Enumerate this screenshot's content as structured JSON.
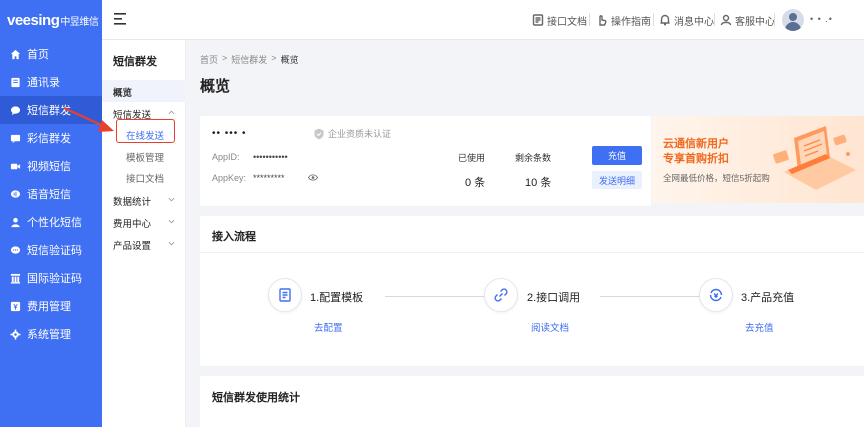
{
  "brand": {
    "logo_text": "veesing",
    "logo_cn": "中昱维信"
  },
  "sidebar": {
    "items": [
      {
        "label": "首页",
        "icon": "home-icon"
      },
      {
        "label": "通讯录",
        "icon": "contacts-icon"
      },
      {
        "label": "短信群发",
        "icon": "message-icon",
        "active": true
      },
      {
        "label": "彩信群发",
        "icon": "mms-icon"
      },
      {
        "label": "视频短信",
        "icon": "video-icon"
      },
      {
        "label": "语音短信",
        "icon": "voice-icon"
      },
      {
        "label": "个性化短信",
        "icon": "personalize-icon"
      },
      {
        "label": "短信验证码",
        "icon": "verify-icon"
      },
      {
        "label": "国际验证码",
        "icon": "international-icon"
      },
      {
        "label": "费用管理",
        "icon": "fee-icon"
      },
      {
        "label": "系统管理",
        "icon": "settings-icon"
      }
    ]
  },
  "header": {
    "links": [
      {
        "label": "接口文档",
        "icon": "document-icon"
      },
      {
        "label": "操作指南",
        "icon": "hand-icon"
      },
      {
        "label": "消息中心",
        "icon": "bell-icon"
      },
      {
        "label": "客服中心",
        "icon": "support-icon"
      }
    ],
    "username": "• • .•"
  },
  "subnav": {
    "title": "短信群发",
    "overview": "概览",
    "group_send": "短信发送",
    "send_online": "在线发送",
    "template": "模板管理",
    "api_doc": "接口文档",
    "data_stats": "数据统计",
    "fee_center": "费用中心",
    "product_settings": "产品设置"
  },
  "breadcrumb": {
    "home": "首页",
    "section": "短信群发",
    "current": "概览",
    "sep": ">"
  },
  "page_title": "概览",
  "account": {
    "name": "••  ••• •",
    "cert_status": "企业资质未认证",
    "appid_label": "AppID:",
    "appid_value": "•••••••••••",
    "appkey_label": "AppKey:",
    "appkey_value": "*********",
    "used_label": "已使用",
    "used_value": "0 条",
    "remain_label": "剩余条数",
    "remain_value": "10 条",
    "recharge_btn": "充值",
    "detail_btn": "发送明细"
  },
  "promo": {
    "line1": "云通信新用户",
    "line2": "专享首购折扣",
    "line3": "全网最低价格，短信5折起购"
  },
  "flow": {
    "title": "接入流程",
    "steps": [
      {
        "label": "1.配置模板",
        "link": "去配置",
        "icon": "template-icon"
      },
      {
        "label": "2.接口调用",
        "link": "阅读文档",
        "icon": "link-icon"
      },
      {
        "label": "3.产品充值",
        "link": "去充值",
        "icon": "recharge-icon"
      }
    ]
  },
  "stats": {
    "title": "短信群发使用统计"
  },
  "colors": {
    "primary": "#3f6ff2",
    "promo": "#f06a1f",
    "highlight": "#e8402a"
  }
}
